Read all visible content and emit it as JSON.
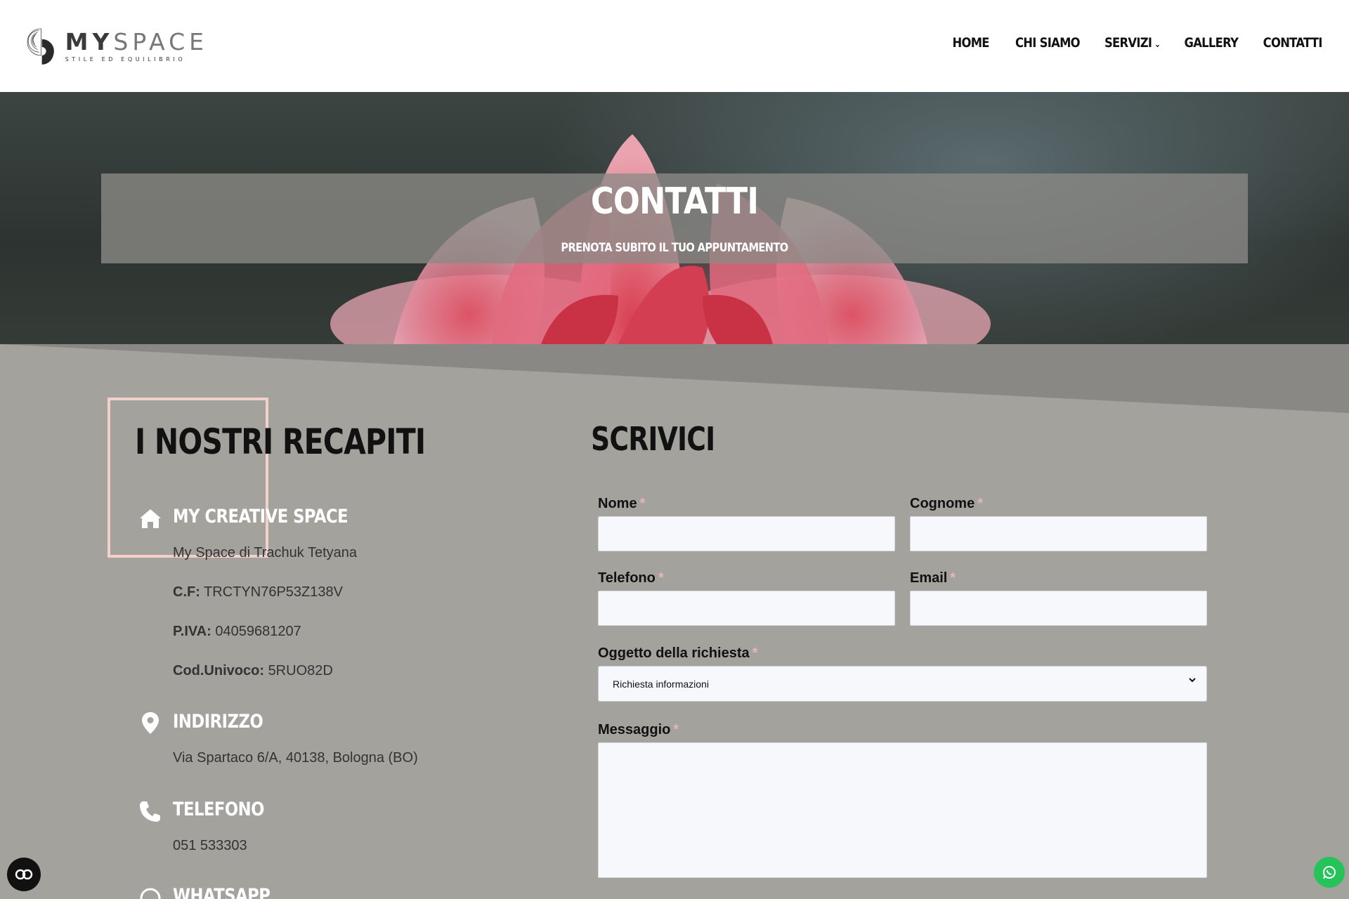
{
  "brand": {
    "name_bold": "MY",
    "name_light": "SPACE",
    "tagline": "STILE ED EQUILIBRIO"
  },
  "nav": {
    "items": [
      {
        "label": "HOME"
      },
      {
        "label": "CHI SIAMO"
      },
      {
        "label": "SERVIZI",
        "has_dropdown": true
      },
      {
        "label": "GALLERY"
      },
      {
        "label": "CONTATTI"
      }
    ]
  },
  "hero": {
    "title": "CONTATTI",
    "subtitle": "PRENOTA SUBITO IL TUO APPUNTAMENTO"
  },
  "contacts": {
    "heading": "I NOSTRI RECAPITI",
    "company": {
      "title": "MY CREATIVE SPACE",
      "owner": "My Space di Trachuk Tetyana",
      "cf_label": "C.F:",
      "cf_value": "TRCTYN76P53Z138V",
      "piva_label": "P.IVA:",
      "piva_value": "04059681207",
      "cod_label": "Cod.Univoco:",
      "cod_value": "5RUO82D",
      "icon": "home-icon"
    },
    "address": {
      "title": "INDIRIZZO",
      "value": "Via Spartaco 6/A, 40138, Bologna (BO)",
      "icon": "map-pin-icon"
    },
    "phone": {
      "title": "TELEFONO",
      "value": "051 533303",
      "icon": "phone-icon"
    },
    "whatsapp": {
      "title": "WHATSAPP",
      "icon": "whatsapp-icon"
    }
  },
  "form": {
    "heading": "SCRIVICI",
    "required_mark": "*",
    "fields": {
      "nome": {
        "label": "Nome",
        "value": ""
      },
      "cognome": {
        "label": "Cognome",
        "value": ""
      },
      "telefono": {
        "label": "Telefono",
        "value": ""
      },
      "email": {
        "label": "Email",
        "value": ""
      },
      "oggetto": {
        "label": "Oggetto della richiesta",
        "value": "Richiesta informazioni"
      },
      "messaggio": {
        "label": "Messaggio",
        "value": ""
      }
    }
  },
  "floating": {
    "left_icon": "accessibility-icon",
    "right_icon": "whatsapp-icon"
  },
  "colors": {
    "section_bg": "#a3a29d",
    "slant": "#8a8884",
    "title_white": "#ffffff",
    "required": "#e8b4b4",
    "deco_frame": "#f2d1cc",
    "whatsapp_green": "#25c35a"
  }
}
